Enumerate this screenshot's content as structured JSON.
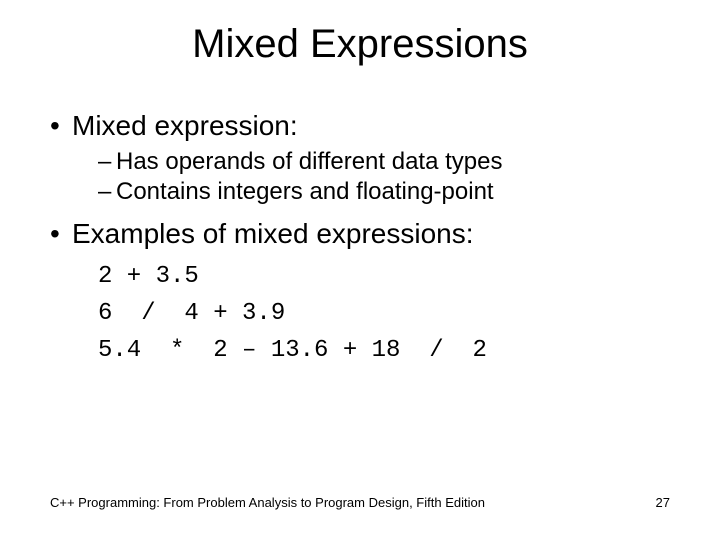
{
  "title": "Mixed Expressions",
  "bullets": {
    "b1a": "Mixed expression:",
    "b2a": "Has operands of different data types",
    "b2b": "Contains integers and floating-point",
    "b1b": "Examples of mixed expressions:"
  },
  "code": {
    "line1": "2 + 3.5",
    "line2": "6  /  4 + 3.9",
    "line3": "5.4  *  2 – 13.6 + 18  /  2"
  },
  "footer": {
    "left": "C++ Programming: From Problem Analysis to Program Design, Fifth Edition",
    "page": "27"
  }
}
